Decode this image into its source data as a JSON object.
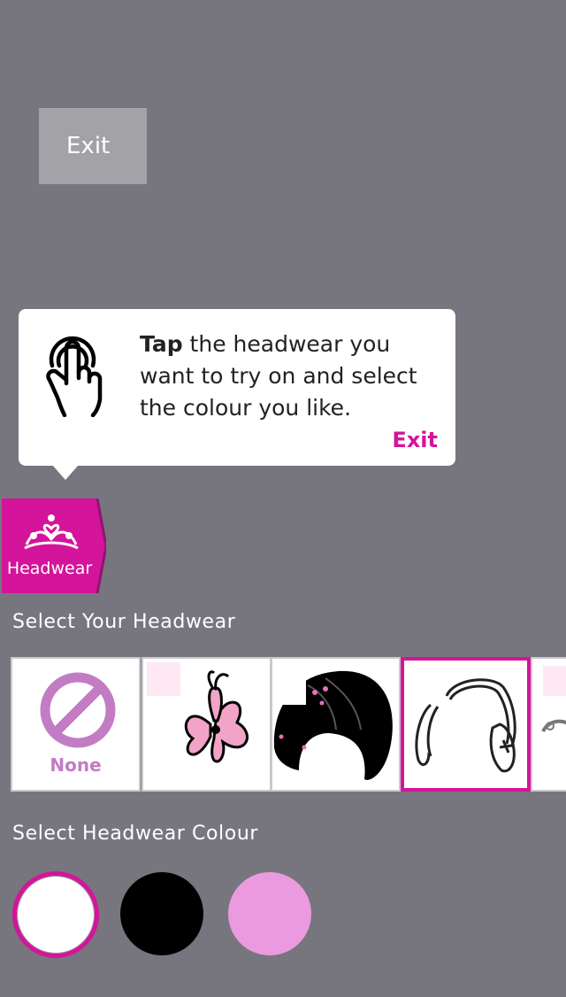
{
  "top": {
    "exit_label": "Exit"
  },
  "tooltip": {
    "bold_word": "Tap",
    "body_text": " the headwear you want to try on and select the colour you like.",
    "exit_label": "Exit",
    "icon": "tap-hand-icon"
  },
  "tab": {
    "label": "Headwear",
    "icon": "tiara-icon",
    "color": "#d4149a"
  },
  "headwear_section": {
    "title": "Select Your Headwear",
    "items": [
      {
        "name": "none",
        "label": "None",
        "icon": "none-icon"
      },
      {
        "name": "flower-clip",
        "icon": "flower-clip-icon"
      },
      {
        "name": "black-hat",
        "icon": "black-hat-icon"
      },
      {
        "name": "earmuffs",
        "icon": "earmuffs-icon",
        "selected": true
      },
      {
        "name": "tiara",
        "icon": "tiara-icon"
      }
    ]
  },
  "colour_section": {
    "title": "Select Headwear Colour",
    "swatches": [
      {
        "name": "white",
        "color": "#ffffff",
        "selected": true
      },
      {
        "name": "black",
        "color": "#000000"
      },
      {
        "name": "pink",
        "color": "#eb9ae0"
      }
    ]
  },
  "colors": {
    "background": "#77767e",
    "accent": "#d4149a"
  }
}
